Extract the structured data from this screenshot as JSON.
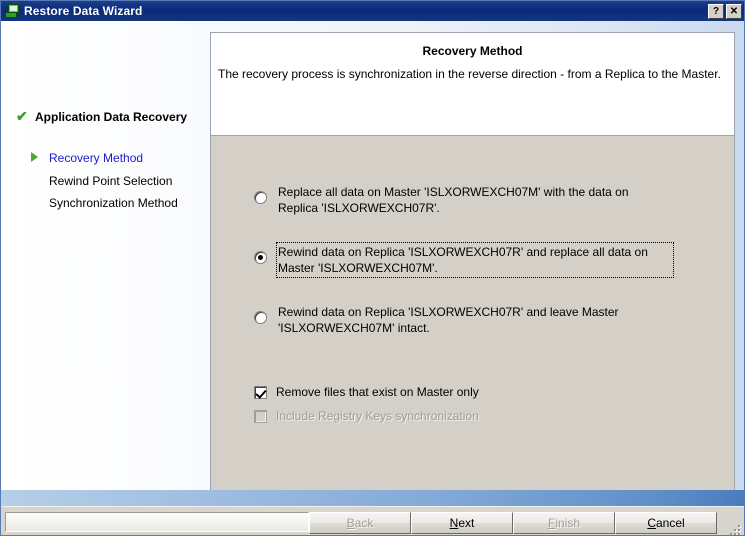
{
  "window": {
    "title": "Restore Data Wizard",
    "icon": "computer-monitor-icon",
    "help_button": "?",
    "close_button": "✕"
  },
  "sidebar": {
    "stages": [
      {
        "label": "Application Data Recovery",
        "state": "completed",
        "marker": "check-icon"
      },
      {
        "label": "Recovery Method",
        "state": "current",
        "marker": "triangle-right-icon"
      },
      {
        "label": "Rewind Point Selection",
        "state": "pending",
        "marker": "none"
      },
      {
        "label": "Synchronization Method",
        "state": "pending",
        "marker": "none"
      }
    ]
  },
  "panel": {
    "title": "Recovery Method",
    "description": "The recovery process is synchronization in the reverse direction - from a Replica to the Master.",
    "options": [
      {
        "id": "replace-master-from-replica",
        "label": "Replace all data on Master 'ISLXORWEXCH07M' with the data on Replica 'ISLXORWEXCH07R'.",
        "checked": false,
        "focused": false
      },
      {
        "id": "rewind-replica-replace-master",
        "label": "Rewind data on Replica 'ISLXORWEXCH07R' and replace all data on Master 'ISLXORWEXCH07M'.",
        "checked": true,
        "focused": true
      },
      {
        "id": "rewind-replica-leave-master",
        "label": "Rewind data on Replica 'ISLXORWEXCH07R' and leave Master 'ISLXORWEXCH07M' intact.",
        "checked": false,
        "focused": false
      }
    ],
    "checkboxes": [
      {
        "id": "remove-files-master-only",
        "label": "Remove files that exist on Master only",
        "checked": true,
        "disabled": false
      },
      {
        "id": "include-registry-keys",
        "label": "Include Registry Keys synchronization",
        "checked": false,
        "disabled": true
      }
    ]
  },
  "statusbar": {
    "text": ""
  },
  "buttons": {
    "back": {
      "label": "Back",
      "accel": "B",
      "before": "",
      "after": "ack",
      "disabled": true
    },
    "next": {
      "label": "Next",
      "accel": "N",
      "before": "",
      "after": "ext",
      "disabled": false
    },
    "finish": {
      "label": "Finish",
      "accel": "F",
      "before": "",
      "after": "inish",
      "disabled": true
    },
    "cancel": {
      "label": "Cancel",
      "accel": "C",
      "before": "",
      "after": "ancel",
      "disabled": false
    }
  },
  "colors": {
    "titlebar": "#0b2a78",
    "panel_face": "#d4d0c8",
    "current_step": "#1a1ad0",
    "completed_marker": "#3a9e29",
    "band": "#7fa7d6"
  }
}
